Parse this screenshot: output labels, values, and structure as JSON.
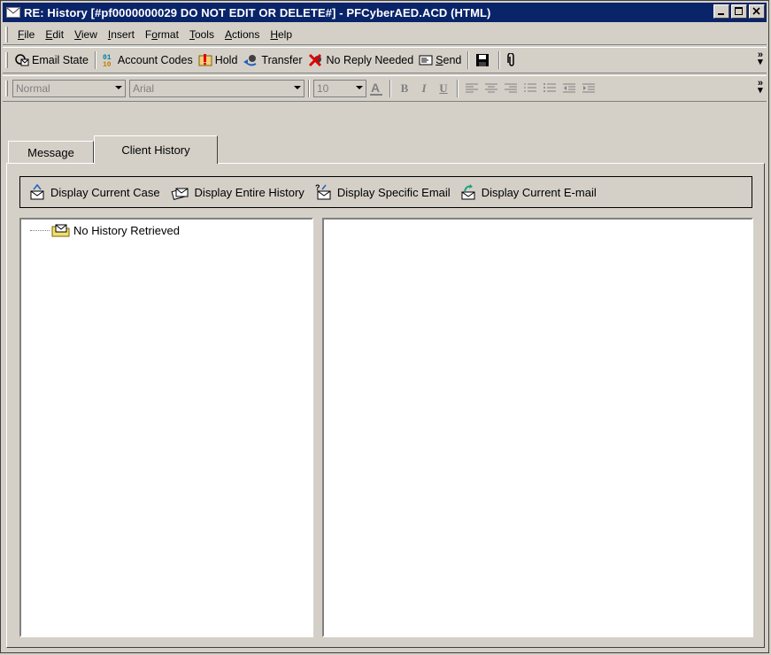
{
  "window": {
    "title": "RE: History [#pf0000000029 DO NOT EDIT OR DELETE#] - PFCyberAED.ACD (HTML)"
  },
  "menu": [
    {
      "key": "F",
      "rest": "ile"
    },
    {
      "key": "E",
      "rest": "dit"
    },
    {
      "key": "V",
      "rest": "iew"
    },
    {
      "key": "I",
      "rest": "nsert"
    },
    {
      "key": "o",
      "pre": "F",
      "rest": "rmat"
    },
    {
      "key": "T",
      "rest": "ools"
    },
    {
      "key": "A",
      "rest": "ctions"
    },
    {
      "key": "H",
      "rest": "elp"
    }
  ],
  "toolbar": {
    "email_state": "Email State",
    "account_codes": "Account Codes",
    "hold": "Hold",
    "transfer": "Transfer",
    "no_reply": "No Reply Needed",
    "send": "Send",
    "more": "»"
  },
  "format": {
    "style": "Normal",
    "font": "Arial",
    "size": "10",
    "bold": "B",
    "italic": "I",
    "underline": "U"
  },
  "tabs": {
    "message": "Message",
    "client_history": "Client History",
    "active": "Client History"
  },
  "history_toolbar": {
    "current_case": "Display Current Case",
    "entire_history": "Display Entire History",
    "specific_email": "Display Specific Email",
    "current_email": "Display Current E-mail"
  },
  "tree": {
    "root_label": "No History Retrieved"
  },
  "colors": {
    "titlebar": "#0a246a",
    "chrome": "#d4d0c8"
  }
}
